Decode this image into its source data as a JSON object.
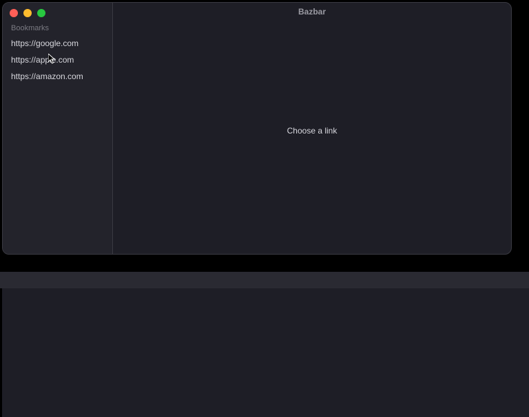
{
  "window": {
    "title": "Bazbar"
  },
  "sidebar": {
    "header": "Bookmarks",
    "bookmarks": [
      {
        "url": "https://google.com"
      },
      {
        "url": "https://apple.com"
      },
      {
        "url": "https://amazon.com"
      }
    ]
  },
  "main": {
    "placeholder": "Choose a link"
  }
}
